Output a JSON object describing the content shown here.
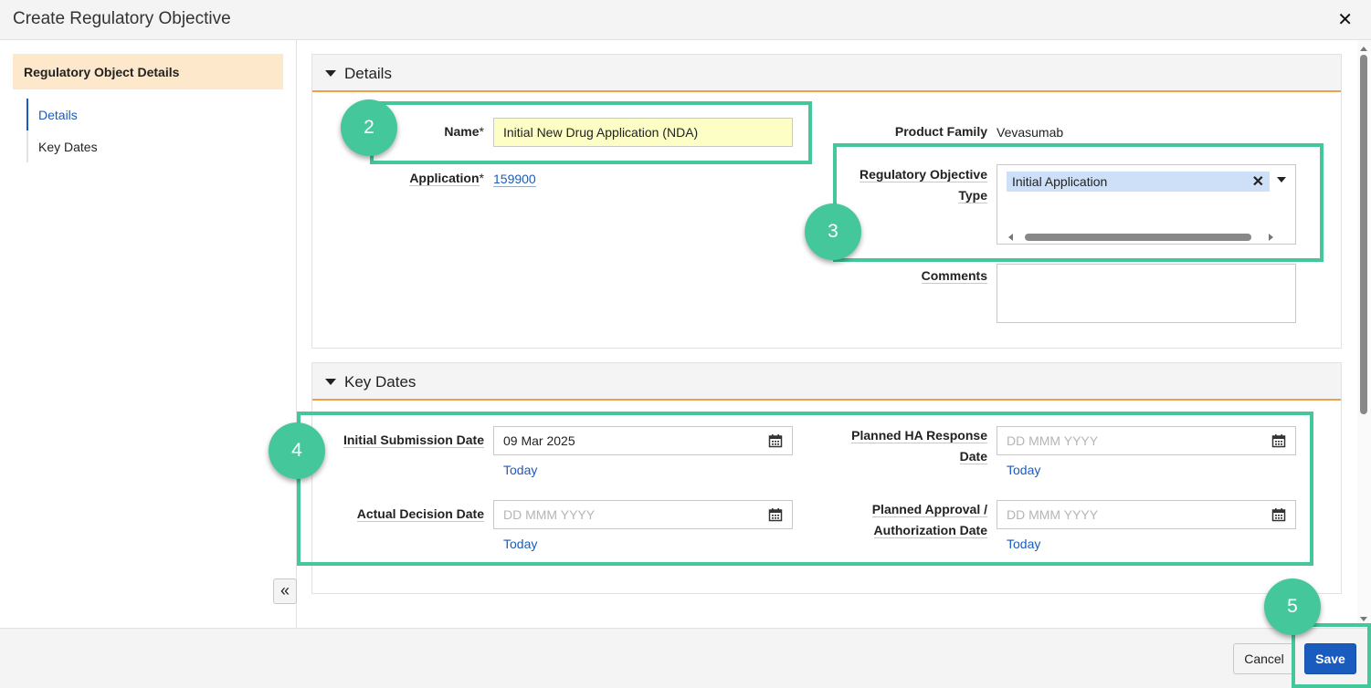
{
  "dialog": {
    "title": "Create Regulatory Objective",
    "close_glyph": "✕"
  },
  "sidebar": {
    "section_title": "Regulatory Object Details",
    "items": [
      {
        "label": "Details",
        "active": true
      },
      {
        "label": "Key Dates",
        "active": false
      }
    ],
    "collapse_glyph": "«"
  },
  "details": {
    "title": "Details",
    "name_label": "Name",
    "name_value": "Initial New Drug Application (NDA)",
    "application_label": "Application",
    "application_value": "159900",
    "required_mark": "*",
    "product_family_label": "Product Family",
    "product_family_value": "Vevasumab",
    "reg_type_label_line1": "Regulatory Objective",
    "reg_type_label_line2": "Type",
    "reg_type_chip": "Initial Application",
    "chip_remove_glyph": "✕",
    "comments_label": "Comments"
  },
  "key_dates": {
    "title": "Key Dates",
    "initial_submission_label": "Initial Submission Date",
    "initial_submission_value": "09 Mar 2025",
    "planned_ha_label_line1": "Planned HA Response",
    "planned_ha_label_line2": "Date",
    "actual_decision_label": "Actual Decision Date",
    "planned_approval_label_line1": "Planned Approval /",
    "planned_approval_label_line2": "Authorization Date",
    "date_placeholder": "DD MMM YYYY",
    "today_label": "Today"
  },
  "footer": {
    "cancel_label": "Cancel",
    "save_label": "Save"
  },
  "callouts": [
    "2",
    "3",
    "4",
    "5"
  ],
  "colors": {
    "accent_blue": "#1a5bbf",
    "callout_green": "#45c79c",
    "section_orange": "#f0a04b",
    "sidebar_header_bg": "#fde8cc",
    "name_field_bg": "#fdfdc6"
  },
  "icons": {
    "calendar": "calendar-icon",
    "caret": "caret-down-icon",
    "collapse": "double-chevron-left-icon"
  }
}
